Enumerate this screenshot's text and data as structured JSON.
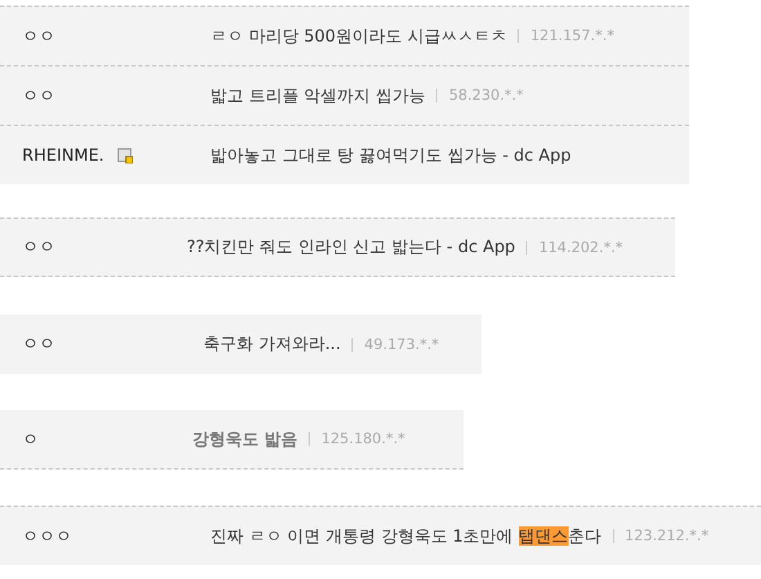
{
  "comments": [
    {
      "author": "ㅇㅇ",
      "badge": false,
      "kind": "normal",
      "parts": [
        {
          "text": "ㄹㅇ 마리당 500원이라도 시급ㅆㅅㅌㅊ",
          "highlight": false
        }
      ],
      "ip": "121.157.*.*"
    },
    {
      "author": "ㅇㅇ",
      "badge": false,
      "kind": "normal",
      "parts": [
        {
          "text": "밟고 트리플 악셀까지 씹가능",
          "highlight": false
        }
      ],
      "ip": "58.230.*.*"
    },
    {
      "author": "RHEINME.",
      "badge": true,
      "kind": "normal",
      "parts": [
        {
          "text": "밟아놓고 그대로 탕 끓여먹기도 씹가능 - dc App",
          "highlight": false
        }
      ]
    },
    {
      "author": "ㅇㅇ",
      "badge": false,
      "kind": "normal",
      "parts": [
        {
          "text": "??치킨만 줘도 인라인 신고 밟는다 - dc App",
          "highlight": false
        }
      ],
      "ip": "114.202.*.*"
    },
    {
      "author": "ㅇㅇ",
      "badge": false,
      "kind": "normal",
      "parts": [
        {
          "text": "축구화 가져와라...",
          "highlight": false
        }
      ],
      "ip": "49.173.*.*"
    },
    {
      "author": "ㅇ",
      "badge": false,
      "kind": "muted",
      "parts": [
        {
          "text": "강형욱도 밟음",
          "highlight": false
        }
      ],
      "ip": "125.180.*.*"
    },
    {
      "author": "ㅇㅇㅇ",
      "badge": false,
      "kind": "normal",
      "parts": [
        {
          "text": "진짜 ㄹㅇ 이면 개통령 강형욱도 1초만에 ",
          "highlight": false
        },
        {
          "text": "탭댄스",
          "highlight": true
        },
        {
          "text": "춘다",
          "highlight": false
        }
      ],
      "ip": "123.212.*.*"
    }
  ]
}
